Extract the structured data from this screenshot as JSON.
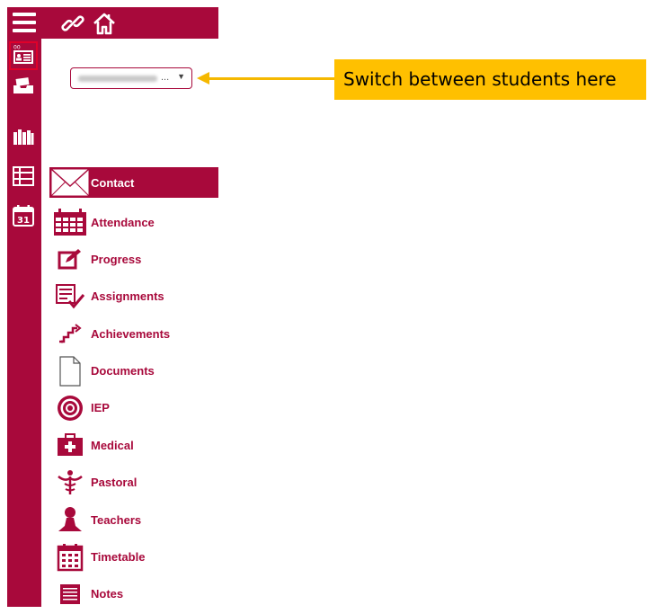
{
  "brand_color": "#a8093b",
  "callout_color": "#ffc000",
  "topbar": {
    "icons": [
      "hamburger-icon",
      "link-icon",
      "home-icon"
    ]
  },
  "rail": {
    "items": [
      {
        "icon": "student-card-icon",
        "active": true
      },
      {
        "icon": "inbox-icon",
        "active": false
      },
      {
        "icon": "library-icon",
        "active": false
      },
      {
        "icon": "list-view-icon",
        "active": false
      },
      {
        "icon": "calendar-icon",
        "active": false,
        "text": "31"
      }
    ]
  },
  "student_selector": {
    "ellipsis": "...",
    "caret": "▼"
  },
  "callout": {
    "text": "Switch between students here"
  },
  "menu": {
    "items": [
      {
        "label": "Contact",
        "icon": "envelope-icon",
        "active": true
      },
      {
        "label": "Attendance",
        "icon": "calendar-grid-icon",
        "active": false
      },
      {
        "label": "Progress",
        "icon": "edit-icon",
        "active": false
      },
      {
        "label": "Assignments",
        "icon": "checklist-icon",
        "active": false
      },
      {
        "label": "Achievements",
        "icon": "stairs-icon",
        "active": false
      },
      {
        "label": "Documents",
        "icon": "document-icon",
        "active": false
      },
      {
        "label": "IEP",
        "icon": "target-icon",
        "active": false
      },
      {
        "label": "Medical",
        "icon": "medical-kit-icon",
        "active": false
      },
      {
        "label": "Pastoral",
        "icon": "caduceus-icon",
        "active": false
      },
      {
        "label": "Teachers",
        "icon": "teacher-icon",
        "active": false
      },
      {
        "label": "Timetable",
        "icon": "timetable-icon",
        "active": false
      },
      {
        "label": "Notes",
        "icon": "notes-icon",
        "active": false
      }
    ]
  }
}
